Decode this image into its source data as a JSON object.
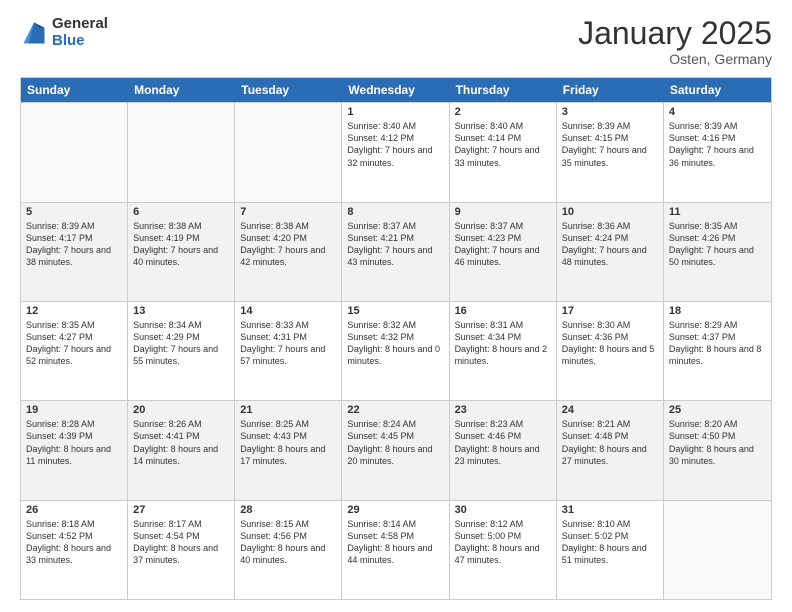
{
  "logo": {
    "general": "General",
    "blue": "Blue"
  },
  "header": {
    "month": "January 2025",
    "location": "Osten, Germany"
  },
  "weekdays": [
    "Sunday",
    "Monday",
    "Tuesday",
    "Wednesday",
    "Thursday",
    "Friday",
    "Saturday"
  ],
  "rows": [
    [
      {
        "day": "",
        "empty": true
      },
      {
        "day": "",
        "empty": true
      },
      {
        "day": "",
        "empty": true
      },
      {
        "day": "1",
        "sunrise": "8:40 AM",
        "sunset": "4:12 PM",
        "daylight": "7 hours and 32 minutes."
      },
      {
        "day": "2",
        "sunrise": "8:40 AM",
        "sunset": "4:14 PM",
        "daylight": "7 hours and 33 minutes."
      },
      {
        "day": "3",
        "sunrise": "8:39 AM",
        "sunset": "4:15 PM",
        "daylight": "7 hours and 35 minutes."
      },
      {
        "day": "4",
        "sunrise": "8:39 AM",
        "sunset": "4:16 PM",
        "daylight": "7 hours and 36 minutes."
      }
    ],
    [
      {
        "day": "5",
        "sunrise": "8:39 AM",
        "sunset": "4:17 PM",
        "daylight": "7 hours and 38 minutes."
      },
      {
        "day": "6",
        "sunrise": "8:38 AM",
        "sunset": "4:19 PM",
        "daylight": "7 hours and 40 minutes."
      },
      {
        "day": "7",
        "sunrise": "8:38 AM",
        "sunset": "4:20 PM",
        "daylight": "7 hours and 42 minutes."
      },
      {
        "day": "8",
        "sunrise": "8:37 AM",
        "sunset": "4:21 PM",
        "daylight": "7 hours and 43 minutes."
      },
      {
        "day": "9",
        "sunrise": "8:37 AM",
        "sunset": "4:23 PM",
        "daylight": "7 hours and 46 minutes."
      },
      {
        "day": "10",
        "sunrise": "8:36 AM",
        "sunset": "4:24 PM",
        "daylight": "7 hours and 48 minutes."
      },
      {
        "day": "11",
        "sunrise": "8:35 AM",
        "sunset": "4:26 PM",
        "daylight": "7 hours and 50 minutes."
      }
    ],
    [
      {
        "day": "12",
        "sunrise": "8:35 AM",
        "sunset": "4:27 PM",
        "daylight": "7 hours and 52 minutes."
      },
      {
        "day": "13",
        "sunrise": "8:34 AM",
        "sunset": "4:29 PM",
        "daylight": "7 hours and 55 minutes."
      },
      {
        "day": "14",
        "sunrise": "8:33 AM",
        "sunset": "4:31 PM",
        "daylight": "7 hours and 57 minutes."
      },
      {
        "day": "15",
        "sunrise": "8:32 AM",
        "sunset": "4:32 PM",
        "daylight": "8 hours and 0 minutes."
      },
      {
        "day": "16",
        "sunrise": "8:31 AM",
        "sunset": "4:34 PM",
        "daylight": "8 hours and 2 minutes."
      },
      {
        "day": "17",
        "sunrise": "8:30 AM",
        "sunset": "4:36 PM",
        "daylight": "8 hours and 5 minutes."
      },
      {
        "day": "18",
        "sunrise": "8:29 AM",
        "sunset": "4:37 PM",
        "daylight": "8 hours and 8 minutes."
      }
    ],
    [
      {
        "day": "19",
        "sunrise": "8:28 AM",
        "sunset": "4:39 PM",
        "daylight": "8 hours and 11 minutes."
      },
      {
        "day": "20",
        "sunrise": "8:26 AM",
        "sunset": "4:41 PM",
        "daylight": "8 hours and 14 minutes."
      },
      {
        "day": "21",
        "sunrise": "8:25 AM",
        "sunset": "4:43 PM",
        "daylight": "8 hours and 17 minutes."
      },
      {
        "day": "22",
        "sunrise": "8:24 AM",
        "sunset": "4:45 PM",
        "daylight": "8 hours and 20 minutes."
      },
      {
        "day": "23",
        "sunrise": "8:23 AM",
        "sunset": "4:46 PM",
        "daylight": "8 hours and 23 minutes."
      },
      {
        "day": "24",
        "sunrise": "8:21 AM",
        "sunset": "4:48 PM",
        "daylight": "8 hours and 27 minutes."
      },
      {
        "day": "25",
        "sunrise": "8:20 AM",
        "sunset": "4:50 PM",
        "daylight": "8 hours and 30 minutes."
      }
    ],
    [
      {
        "day": "26",
        "sunrise": "8:18 AM",
        "sunset": "4:52 PM",
        "daylight": "8 hours and 33 minutes."
      },
      {
        "day": "27",
        "sunrise": "8:17 AM",
        "sunset": "4:54 PM",
        "daylight": "8 hours and 37 minutes."
      },
      {
        "day": "28",
        "sunrise": "8:15 AM",
        "sunset": "4:56 PM",
        "daylight": "8 hours and 40 minutes."
      },
      {
        "day": "29",
        "sunrise": "8:14 AM",
        "sunset": "4:58 PM",
        "daylight": "8 hours and 44 minutes."
      },
      {
        "day": "30",
        "sunrise": "8:12 AM",
        "sunset": "5:00 PM",
        "daylight": "8 hours and 47 minutes."
      },
      {
        "day": "31",
        "sunrise": "8:10 AM",
        "sunset": "5:02 PM",
        "daylight": "8 hours and 51 minutes."
      },
      {
        "day": "",
        "empty": true
      }
    ]
  ]
}
